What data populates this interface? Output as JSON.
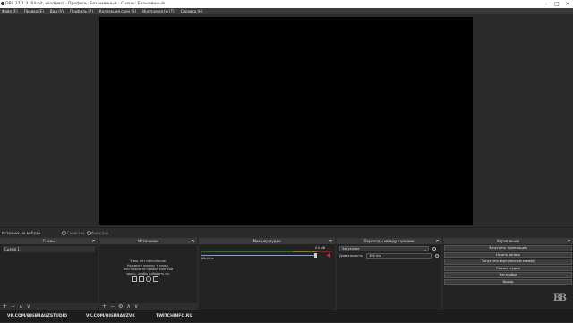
{
  "titlebar": {
    "title": "OBS 27.1.3 (64-bit, windows) - Профиль: Безымянный - Сцены: Безымянный"
  },
  "menu": [
    "Файл (F)",
    "Правка (E)",
    "Вид (V)",
    "Профиль (P)",
    "Коллекция сцен (S)",
    "Инструменты (T)",
    "Справка (H)"
  ],
  "source_bar": {
    "label": "Источник не выбран",
    "properties": "Свойства",
    "filters": "Фильтры"
  },
  "scenes": {
    "title": "Сцены",
    "items": [
      "Сцена 1"
    ]
  },
  "sources": {
    "title": "Источники",
    "empty_text": [
      "У вас нет источников.",
      "Нажмите кнопку + ниже,",
      "или нажмите правой кнопкой",
      "здесь, чтобы добавить их."
    ]
  },
  "mixer": {
    "title": "Микшер аудио",
    "channel": "Mic/Aux",
    "db": "0.0 dB"
  },
  "transitions": {
    "title": "Переходы между сценами",
    "type": "Затухание",
    "duration_label": "Длительность",
    "duration": "300 ms"
  },
  "controls": {
    "title": "Управление",
    "buttons": [
      "Запустить трансляцию",
      "Начать запись",
      "Запустить виртуальную камеру",
      "Режим студии",
      "Настройки",
      "Выход"
    ]
  },
  "status": {
    "items": [
      "VK.COM/BIGBRAUZSTUDIO",
      "VK.COM/BIGBRAUZVK",
      "TWITCHINFO.RU"
    ]
  },
  "icons": {
    "app": "obs-icon",
    "logo": "bb-logo",
    "mute": "mute-icon"
  },
  "colors": {
    "canvas": "#000000",
    "background": "#2b2b2b",
    "meter_green": "#3d6b2b",
    "slider_blue": "#7aa0d9",
    "mute_red": "#dd3333"
  }
}
